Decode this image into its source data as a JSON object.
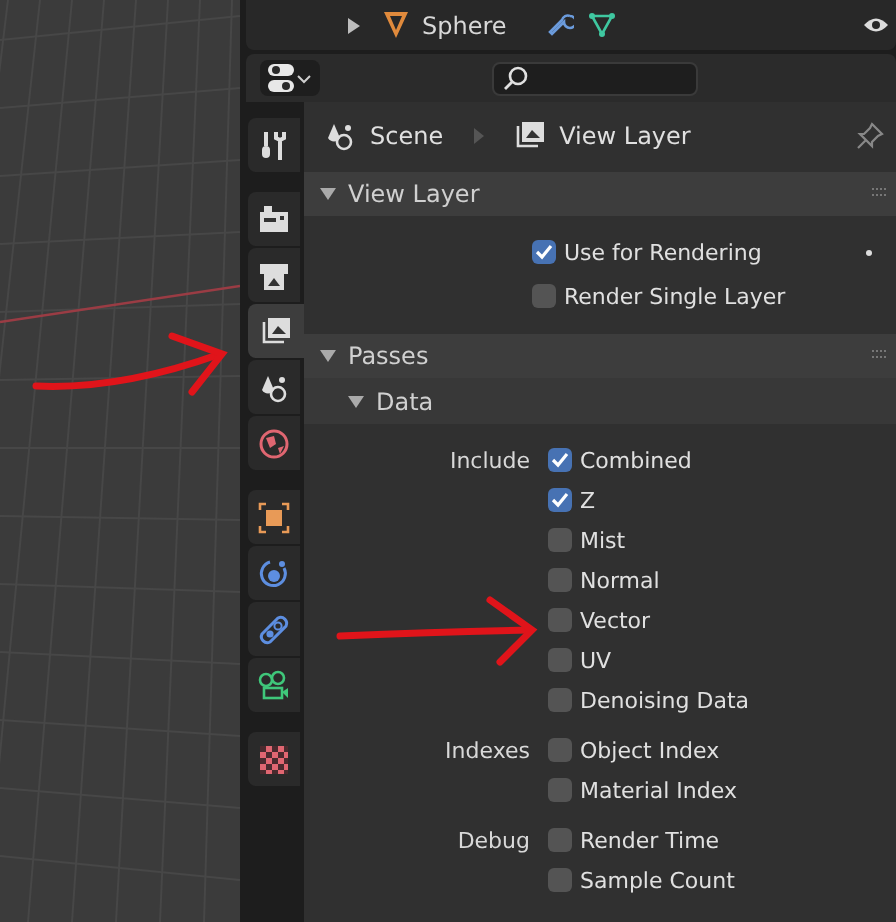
{
  "outliner": {
    "object": "Sphere",
    "expanded": false
  },
  "tab_groups": [
    [
      {
        "kind": "tool",
        "selected": false
      }
    ],
    [
      {
        "kind": "render",
        "selected": false
      },
      {
        "kind": "output",
        "selected": false
      },
      {
        "kind": "view_layer",
        "selected": true
      },
      {
        "kind": "scene",
        "selected": false
      },
      {
        "kind": "world",
        "selected": false
      }
    ],
    [
      {
        "kind": "object",
        "selected": false
      },
      {
        "kind": "physics",
        "selected": false
      },
      {
        "kind": "constraints",
        "selected": false
      },
      {
        "kind": "data",
        "selected": false
      }
    ],
    [
      {
        "kind": "texture",
        "selected": false
      }
    ]
  ],
  "breadcrumb": [
    "Scene",
    "View Layer"
  ],
  "view_layer_panel": {
    "title": "View Layer",
    "expanded": true,
    "options": [
      {
        "label": "Use for Rendering",
        "checked": true
      },
      {
        "label": "Render Single Layer",
        "checked": false
      }
    ]
  },
  "passes_panel": {
    "title": "Passes",
    "expanded": true,
    "subpanel": {
      "title": "Data",
      "expanded": true,
      "groups": [
        {
          "label": "Include",
          "options": [
            {
              "label": "Combined",
              "checked": true
            },
            {
              "label": "Z",
              "checked": true
            },
            {
              "label": "Mist",
              "checked": false
            },
            {
              "label": "Normal",
              "checked": false
            },
            {
              "label": "Vector",
              "checked": false
            },
            {
              "label": "UV",
              "checked": false
            },
            {
              "label": "Denoising Data",
              "checked": false
            }
          ]
        },
        {
          "label": "Indexes",
          "options": [
            {
              "label": "Object Index",
              "checked": false
            },
            {
              "label": "Material Index",
              "checked": false
            }
          ]
        },
        {
          "label": "Debug",
          "options": [
            {
              "label": "Render Time",
              "checked": false
            },
            {
              "label": "Sample Count",
              "checked": false
            }
          ]
        }
      ]
    }
  }
}
